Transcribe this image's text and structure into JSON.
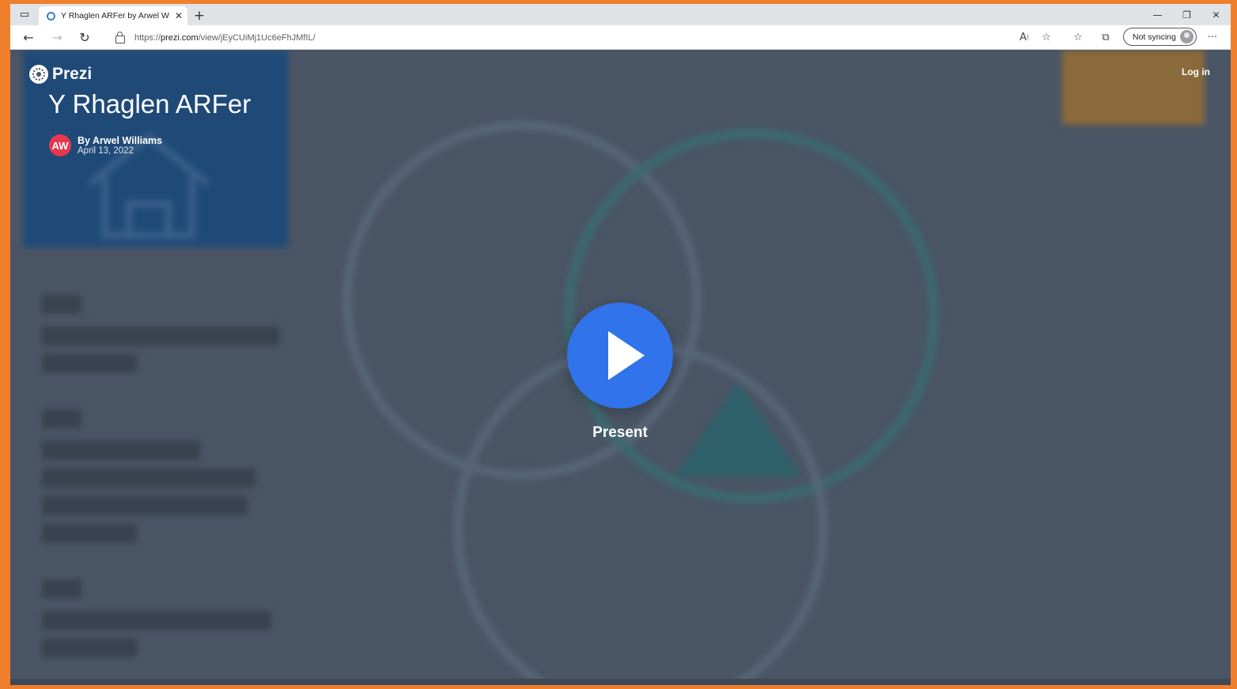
{
  "browser": {
    "tab_title": "Y Rhaglen ARFer by Arwel Willia",
    "url_prefix": "https://",
    "url_domain": "prezi.com",
    "url_path": "/view/jEyCUiMj1Uc6eFhJMfIL/",
    "sync_label": "Not syncing",
    "icons": {
      "tab_actions": "tab-actions-icon",
      "close_tab": "close-icon",
      "new_tab": "plus-icon",
      "minimize": "minimize-icon",
      "restore": "restore-icon",
      "close_window": "close-icon",
      "back": "back-arrow-icon",
      "forward": "forward-arrow-icon",
      "refresh": "refresh-icon",
      "lock": "lock-icon",
      "read_aloud": "read-aloud-icon",
      "add_favorite": "add-favorite-icon",
      "favorites": "favorites-icon",
      "collections": "collections-icon",
      "more": "more-icon"
    }
  },
  "page": {
    "logo_text": "Prezi",
    "title": "Y Rhaglen ARFer",
    "author_initials": "AW",
    "author_name": "By Arwel Williams",
    "date": "April 13, 2022",
    "login_label": "Log in",
    "present_label": "Present",
    "colors": {
      "accent_play": "#3073ea",
      "avatar": "#e5384f",
      "backdrop": "#4a5565",
      "frame": "#f07f2c"
    }
  }
}
